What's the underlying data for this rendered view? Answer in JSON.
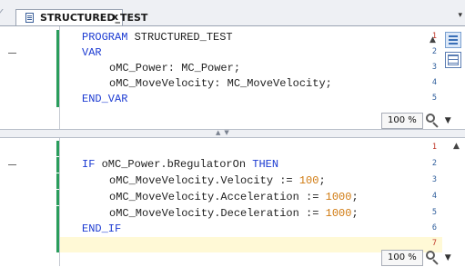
{
  "tab": {
    "title": "STRUCTURED_TEST",
    "close": "x",
    "menu": "▾"
  },
  "declaration_pane": {
    "lines": [
      {
        "num": "1",
        "text": [
          {
            "t": "PROGRAM ",
            "c": "kw"
          },
          {
            "t": "STRUCTURED_TEST",
            "c": ""
          }
        ]
      },
      {
        "num": "2",
        "text": [
          {
            "t": "VAR",
            "c": "kw"
          }
        ]
      },
      {
        "num": "3",
        "text": [
          {
            "t": "oMC_Power: MC_Power;",
            "c": ""
          }
        ]
      },
      {
        "num": "4",
        "text": [
          {
            "t": "oMC_MoveVelocity: MC_MoveVelocity;",
            "c": ""
          }
        ]
      },
      {
        "num": "5",
        "text": [
          {
            "t": "END_VAR",
            "c": "kw"
          }
        ]
      }
    ],
    "zoom": "100 %"
  },
  "implementation_pane": {
    "lines": [
      {
        "num": "1",
        "text": []
      },
      {
        "num": "2",
        "text": [
          {
            "t": "IF ",
            "c": "kw"
          },
          {
            "t": "oMC_Power.bRegulatorOn ",
            "c": ""
          },
          {
            "t": "THEN",
            "c": "kw"
          }
        ]
      },
      {
        "num": "3",
        "text": [
          {
            "t": "oMC_MoveVelocity.Velocity := ",
            "c": ""
          },
          {
            "t": "100",
            "c": "num"
          },
          {
            "t": ";",
            "c": ""
          }
        ]
      },
      {
        "num": "4",
        "text": [
          {
            "t": "oMC_MoveVelocity.Acceleration := ",
            "c": ""
          },
          {
            "t": "1000",
            "c": "num"
          },
          {
            "t": ";",
            "c": ""
          }
        ]
      },
      {
        "num": "5",
        "text": [
          {
            "t": "oMC_MoveVelocity.Deceleration := ",
            "c": ""
          },
          {
            "t": "1000",
            "c": "num"
          },
          {
            "t": ";",
            "c": ""
          }
        ]
      },
      {
        "num": "6",
        "text": [
          {
            "t": "END_IF",
            "c": "kw"
          }
        ]
      },
      {
        "num": "7",
        "text": []
      }
    ],
    "zoom": "100 %"
  },
  "icons": {
    "tab_icon": "document-icon",
    "side_a": "declaration-textual-view-icon",
    "side_b": "declaration-tabular-view-icon",
    "zoom": "zoom-magnifier-icon",
    "fold": "fold-collapse-icon"
  },
  "colors": {
    "keyword": "#1c3bd2",
    "number": "#d07a10",
    "change_bar": "#2a9d5c",
    "current_line": "#fff9d6"
  }
}
